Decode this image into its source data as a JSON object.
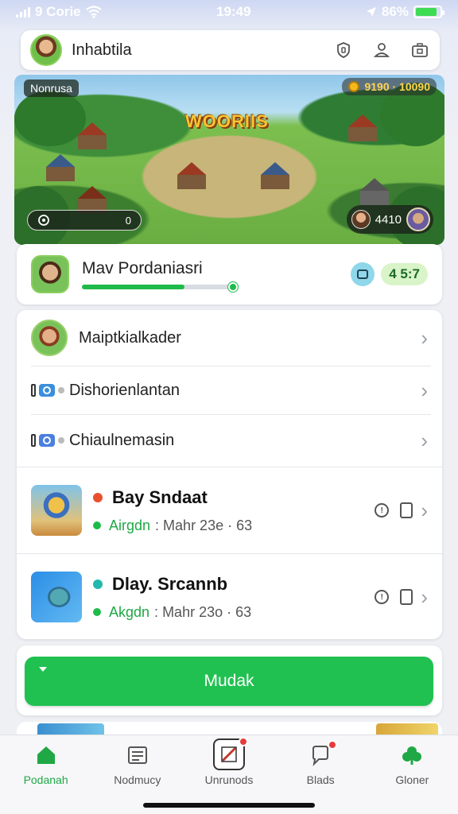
{
  "status_bar": {
    "carrier": "9 Corie",
    "time": "19:49",
    "battery": "86%",
    "battery_level": 0.86
  },
  "header": {
    "title": "Inhabtila",
    "icons": [
      "shield-icon",
      "user-icon",
      "camera-icon"
    ]
  },
  "banner": {
    "tag": "Nonrusa",
    "game_logo": "WOORIIS",
    "coins": "9190 · 10090",
    "pill_value": "0",
    "score": "4410"
  },
  "profile": {
    "name": "Mav Pordaniasri",
    "level": "4 5:7",
    "progress": 0.68
  },
  "menu_items": [
    {
      "label": "Maiptkialkader"
    },
    {
      "label": "Dishorienlantan"
    },
    {
      "label": "Chiaulnemasin"
    }
  ],
  "games": [
    {
      "title": "Bay Sndaat",
      "status": "Airgdn",
      "meta": "Mahr 23e",
      "count": "63",
      "dot_color": "#e8502e"
    },
    {
      "title": "Dlay. Srcannb",
      "status": "Akgdn",
      "meta": "Mahr 23o",
      "count": "63",
      "dot_color": "#22b8b0"
    }
  ],
  "cta": {
    "label": "Mudak"
  },
  "tabs": [
    {
      "label": "Podanah",
      "active": true
    },
    {
      "label": "Nodmucy",
      "active": false
    },
    {
      "label": "Unrunods",
      "active": false
    },
    {
      "label": "Blads",
      "active": false
    },
    {
      "label": "Gloner",
      "active": false
    }
  ],
  "colors": {
    "accent": "#20c151",
    "dark_text": "#1c1c1e"
  }
}
